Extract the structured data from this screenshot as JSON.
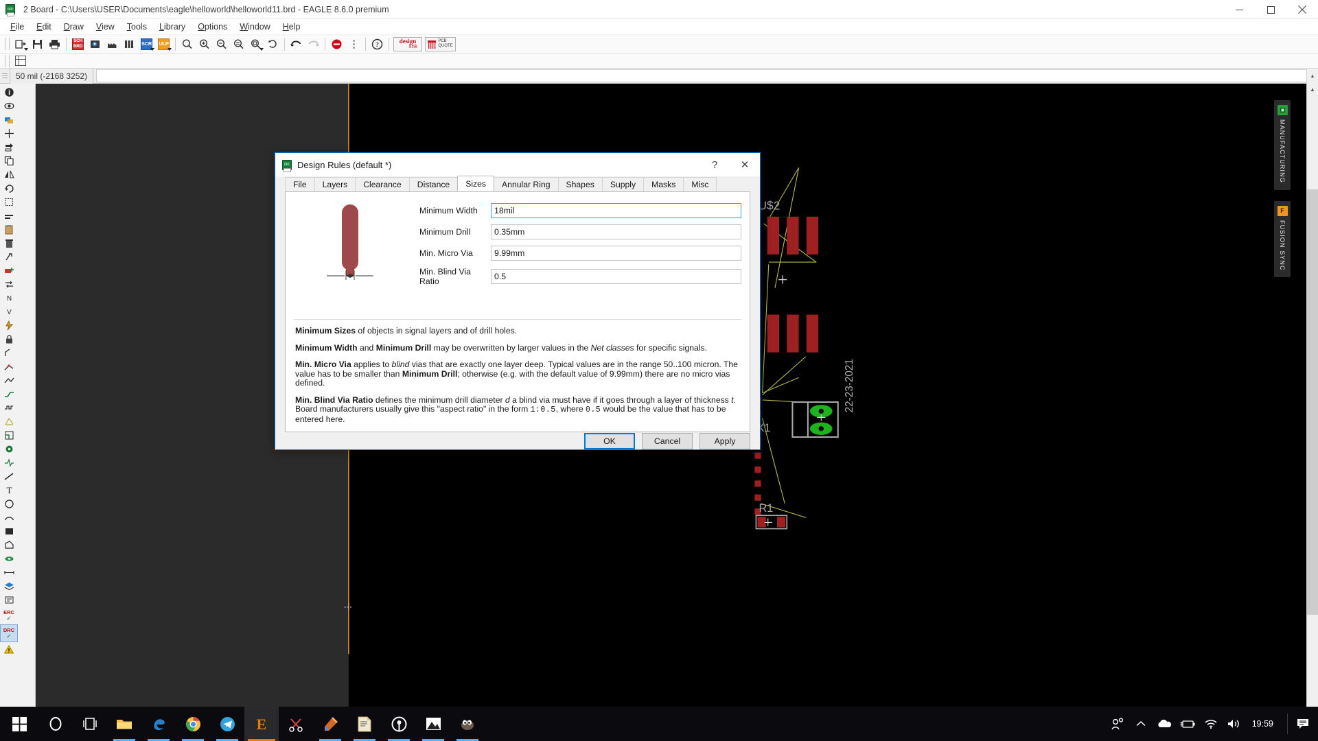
{
  "window": {
    "title": "2 Board - C:\\Users\\USER\\Documents\\eagle\\helloworld\\helloworld11.brd - EAGLE 8.6.0 premium",
    "app_icon": "eagle-brd-icon",
    "minimize_label": "Minimize",
    "maximize_label": "Restore",
    "close_label": "Close"
  },
  "menubar": {
    "items": [
      {
        "label": "File",
        "mnemonic": "F"
      },
      {
        "label": "Edit",
        "mnemonic": "E"
      },
      {
        "label": "Draw",
        "mnemonic": "D"
      },
      {
        "label": "View",
        "mnemonic": "V"
      },
      {
        "label": "Tools",
        "mnemonic": "T"
      },
      {
        "label": "Library",
        "mnemonic": "L"
      },
      {
        "label": "Options",
        "mnemonic": "O"
      },
      {
        "label": "Window",
        "mnemonic": "W"
      },
      {
        "label": "Help",
        "mnemonic": "H"
      }
    ]
  },
  "toolbar": {
    "buttons": [
      {
        "name": "open-icon",
        "label": "Open"
      },
      {
        "name": "save-icon",
        "label": "Save"
      },
      {
        "name": "print-icon",
        "label": "Print"
      },
      {
        "name": "sch-brd-switch-icon",
        "label": "SCH/BRD",
        "text_top": "SCH",
        "text_bottom": "BRD",
        "color": "#d13030"
      },
      {
        "name": "cam-processor-icon",
        "label": "CAM Processor"
      },
      {
        "name": "manufacturing-icon",
        "label": "Manufacturing"
      },
      {
        "name": "library-icon",
        "label": "Library"
      },
      {
        "name": "script-icon",
        "label": "SCR",
        "text": "SCR",
        "color": "#2a6fc2"
      },
      {
        "name": "ulp-icon",
        "label": "ULP",
        "text": "ULP",
        "color": "#f0a020"
      },
      {
        "name": "zoom-fit-icon",
        "label": "Zoom to fit"
      },
      {
        "name": "zoom-in-icon",
        "label": "Zoom in"
      },
      {
        "name": "zoom-out-icon",
        "label": "Zoom out"
      },
      {
        "name": "zoom-redraw-icon",
        "label": "Redraw"
      },
      {
        "name": "zoom-select-icon",
        "label": "Zoom select"
      },
      {
        "name": "refresh-icon",
        "label": "Refresh"
      },
      {
        "name": "undo-icon",
        "label": "Undo"
      },
      {
        "name": "redo-icon",
        "label": "Redo"
      },
      {
        "name": "stop-icon",
        "label": "Stop",
        "color": "#d0021b"
      },
      {
        "name": "drag-handle-icon",
        "label": "Options"
      },
      {
        "name": "help-icon",
        "label": "Help"
      },
      {
        "name": "design-link-icon",
        "label": "design link",
        "text_top": "design",
        "text_bottom": "link"
      },
      {
        "name": "pcb-quote-icon",
        "label": "PCB QUOTE",
        "text_top": "PCB",
        "text_bottom": "QUOTE"
      }
    ],
    "grid_icon": "grid-icon"
  },
  "coordbar": {
    "coordinates": "50 mil (-2168 3252)",
    "command_value": "",
    "command_placeholder": ""
  },
  "left_toolbar": {
    "tools": [
      {
        "name": "info-icon",
        "label": "Info"
      },
      {
        "name": "show-icon",
        "label": "Show"
      },
      {
        "name": "display-icon",
        "label": "Display"
      },
      {
        "name": "mark-icon",
        "label": "Mark"
      },
      {
        "name": "move-icon",
        "label": "Move"
      },
      {
        "name": "copy-icon",
        "label": "Copy"
      },
      {
        "name": "mirror-icon",
        "label": "Mirror"
      },
      {
        "name": "rotate-icon",
        "label": "Rotate"
      },
      {
        "name": "group-icon",
        "label": "Group"
      },
      {
        "name": "change-icon",
        "label": "Change"
      },
      {
        "name": "paste-icon",
        "label": "Paste"
      },
      {
        "name": "delete-icon",
        "label": "Delete"
      },
      {
        "name": "ripup-icon",
        "label": "Ripup"
      },
      {
        "name": "add-icon",
        "label": "Add"
      },
      {
        "name": "replace-icon",
        "label": "Replace"
      },
      {
        "name": "name-icon",
        "label": "Name"
      },
      {
        "name": "value-icon",
        "label": "Value"
      },
      {
        "name": "smash-icon",
        "label": "Smash"
      },
      {
        "name": "lock-icon",
        "label": "Lock"
      },
      {
        "name": "miter-icon",
        "label": "Miter"
      },
      {
        "name": "split-icon",
        "label": "Split"
      },
      {
        "name": "optimize-icon",
        "label": "Optimize"
      },
      {
        "name": "route-icon",
        "label": "Route"
      },
      {
        "name": "meander-icon",
        "label": "Meander"
      },
      {
        "name": "ratsnest-icon",
        "label": "Ratsnest"
      },
      {
        "name": "autorouter-icon",
        "label": "Autorouter"
      },
      {
        "name": "via-icon",
        "label": "Via"
      },
      {
        "name": "signal-icon",
        "label": "Signal"
      },
      {
        "name": "wire-icon",
        "label": "Wire"
      },
      {
        "name": "text-icon",
        "label": "Text"
      },
      {
        "name": "circle-icon",
        "label": "Circle"
      },
      {
        "name": "arc-icon",
        "label": "Arc"
      },
      {
        "name": "rect-icon",
        "label": "Rect"
      },
      {
        "name": "polygon-icon",
        "label": "Polygon"
      },
      {
        "name": "hole-icon",
        "label": "Hole"
      },
      {
        "name": "dimension-icon",
        "label": "Dimension"
      },
      {
        "name": "layers-icon",
        "label": "Layers"
      },
      {
        "name": "attribute-icon",
        "label": "Attribute"
      },
      {
        "name": "erc-icon",
        "label": "ERC"
      },
      {
        "name": "drc-icon",
        "label": "DRC"
      },
      {
        "name": "warn-icon",
        "label": "Warnings"
      }
    ],
    "erc_label": "ERC",
    "drc_label": "DRC"
  },
  "canvas": {
    "components": [
      {
        "name": "U$2",
        "label": "U$2"
      },
      {
        "name": "X1",
        "label": "X1"
      },
      {
        "name": "R1",
        "label": "R1"
      },
      {
        "name": "part-number",
        "label": "22-23-2021"
      }
    ],
    "pad_color": "#9e2020",
    "via_color": "#1db31d",
    "airwire_color": "#b8b84a",
    "outline_color": "#d08a2a",
    "silkscreen_color": "#a9a9a9"
  },
  "right_rail": {
    "tabs": [
      {
        "name": "manufacturing",
        "label": "MANUFACTURING",
        "icon": "chip-icon",
        "icon_color": "#2a9b3a",
        "icon_glyph": "▣"
      },
      {
        "name": "fusion-sync",
        "label": "FUSION SYNC",
        "icon": "fusion-icon",
        "icon_color": "#f0961e",
        "icon_glyph": "F"
      }
    ]
  },
  "dialog": {
    "title": "Design Rules (default *)",
    "icon": "design-rules-icon",
    "help_glyph": "?",
    "close_glyph": "✕",
    "tabs": [
      {
        "label": "File",
        "active": false
      },
      {
        "label": "Layers",
        "active": false
      },
      {
        "label": "Clearance",
        "active": false
      },
      {
        "label": "Distance",
        "active": false
      },
      {
        "label": "Sizes",
        "active": true
      },
      {
        "label": "Annular Ring",
        "active": false
      },
      {
        "label": "Shapes",
        "active": false
      },
      {
        "label": "Supply",
        "active": false
      },
      {
        "label": "Masks",
        "active": false
      },
      {
        "label": "Misc",
        "active": false
      }
    ],
    "fields": [
      {
        "label": "Minimum Width",
        "value": "18mil",
        "name": "minimum-width",
        "focused": true
      },
      {
        "label": "Minimum Drill",
        "value": "0.35mm",
        "name": "minimum-drill",
        "focused": false
      },
      {
        "label": "Min. Micro Via",
        "value": "9.99mm",
        "name": "min-micro-via",
        "focused": false
      },
      {
        "label": "Min. Blind Via Ratio",
        "value": "0.5",
        "name": "min-blind-via-ratio",
        "focused": false
      }
    ],
    "description": [
      {
        "id": "p1",
        "parts": [
          {
            "t": "Minimum Sizes",
            "s": "b"
          },
          {
            "t": " of objects in signal layers and of drill holes.",
            "s": ""
          }
        ]
      },
      {
        "id": "p2",
        "parts": [
          {
            "t": "Minimum Width",
            "s": "b"
          },
          {
            "t": " and ",
            "s": ""
          },
          {
            "t": "Minimum Drill",
            "s": "b"
          },
          {
            "t": " may be overwritten by larger values in the ",
            "s": ""
          },
          {
            "t": "Net classes",
            "s": "i"
          },
          {
            "t": " for specific signals.",
            "s": ""
          }
        ]
      },
      {
        "id": "p3",
        "parts": [
          {
            "t": "Min. Micro Via",
            "s": "b"
          },
          {
            "t": " applies to ",
            "s": ""
          },
          {
            "t": "blind",
            "s": "i"
          },
          {
            "t": " vias that are exactly one layer deep. Typical values are in the range 50..100 micron. The value has to be smaller than ",
            "s": ""
          },
          {
            "t": "Minimum Drill",
            "s": "b"
          },
          {
            "t": "; otherwise (e.g. with the default value of 9.99mm) there are no micro vias defined.",
            "s": ""
          }
        ]
      },
      {
        "id": "p4",
        "parts": [
          {
            "t": "Min. Blind Via Ratio",
            "s": "b"
          },
          {
            "t": " defines the minimum drill diameter ",
            "s": ""
          },
          {
            "t": "d",
            "s": "i"
          },
          {
            "t": " a blind via must have if it goes through a layer of thickness ",
            "s": ""
          },
          {
            "t": "t",
            "s": "i"
          },
          {
            "t": ". Board manufacturers usually give this \"aspect ratio\" in the form ",
            "s": ""
          },
          {
            "t": "1:0.5",
            "s": "c"
          },
          {
            "t": ", where ",
            "s": ""
          },
          {
            "t": "0.5",
            "s": "c"
          },
          {
            "t": " would be the value that has to be entered here.",
            "s": ""
          }
        ]
      }
    ],
    "buttons": [
      {
        "label": "OK",
        "name": "ok-button",
        "primary": true
      },
      {
        "label": "Cancel",
        "name": "cancel-button",
        "primary": false
      },
      {
        "label": "Apply",
        "name": "apply-button",
        "primary": false
      }
    ]
  },
  "taskbar": {
    "start_label": "Start",
    "items": [
      {
        "name": "cortana-icon",
        "label": "Cortana",
        "active": false,
        "running": false
      },
      {
        "name": "task-view-icon",
        "label": "Task View",
        "active": false,
        "running": false
      },
      {
        "name": "file-explorer-icon",
        "label": "File Explorer",
        "active": false,
        "running": true
      },
      {
        "name": "edge-icon",
        "label": "Microsoft Edge",
        "active": false,
        "running": true
      },
      {
        "name": "chrome-icon",
        "label": "Google Chrome",
        "active": false,
        "running": true
      },
      {
        "name": "telegram-icon",
        "label": "Telegram",
        "active": false,
        "running": true
      },
      {
        "name": "eagle-icon",
        "label": "EAGLE",
        "active": true,
        "running": true
      },
      {
        "name": "snipping-tool-icon",
        "label": "Snipping Tool",
        "active": false,
        "running": false
      },
      {
        "name": "paint-icon",
        "label": "Paint",
        "active": false,
        "running": true
      },
      {
        "name": "notepad-icon",
        "label": "Notepad",
        "active": false,
        "running": true
      },
      {
        "name": "proteus-icon",
        "label": "Proteus",
        "active": false,
        "running": true
      },
      {
        "name": "photos-icon",
        "label": "Photos",
        "active": false,
        "running": true
      },
      {
        "name": "gimp-icon",
        "label": "GIMP",
        "active": false,
        "running": true
      }
    ],
    "tray": [
      {
        "name": "people-icon",
        "label": "People"
      },
      {
        "name": "show-hidden-icons-icon",
        "label": "Show hidden icons"
      },
      {
        "name": "onedrive-icon",
        "label": "OneDrive"
      },
      {
        "name": "battery-icon",
        "label": "Battery charging"
      },
      {
        "name": "wifi-icon",
        "label": "Network"
      },
      {
        "name": "volume-icon",
        "label": "Volume"
      }
    ],
    "clock": "19:59",
    "action_center": "notifications-icon"
  },
  "statusbar": {
    "icons": [
      {
        "name": "battery-status-icon",
        "label": "Battery"
      },
      {
        "name": "info-status-icon",
        "label": "Info"
      },
      {
        "name": "message-status-icon",
        "label": "Messages"
      }
    ]
  }
}
